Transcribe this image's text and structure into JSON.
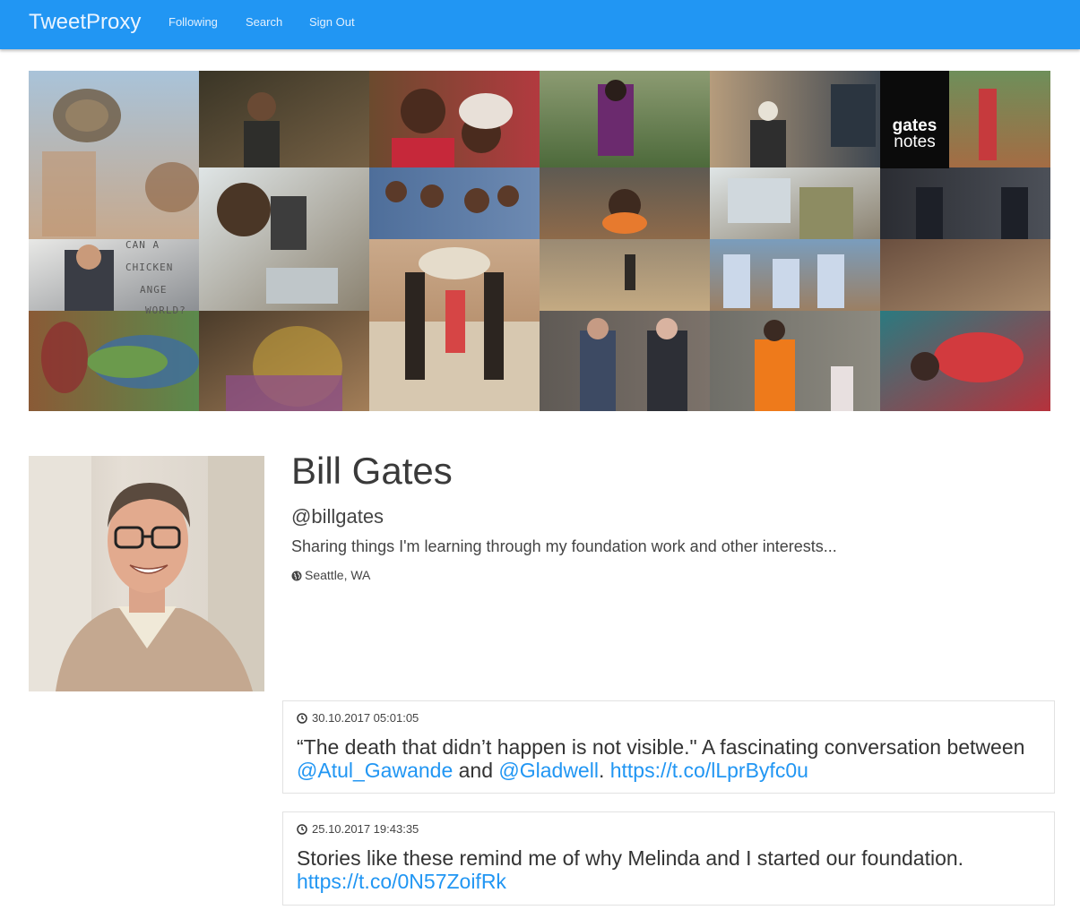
{
  "navbar": {
    "brand": "TweetProxy",
    "links": [
      "Following",
      "Search",
      "Sign Out"
    ]
  },
  "banner": {
    "logo_line1": "gates",
    "logo_line2": "notes",
    "chicken_lines": [
      "CAN A",
      "CHICKEN",
      "ANGE",
      "WORLD?"
    ]
  },
  "profile": {
    "name": "Bill Gates",
    "handle": "@billgates",
    "bio": "Sharing things I'm learning through my foundation work and other interests...",
    "location": "Seattle, WA"
  },
  "tweets": [
    {
      "time": "30.10.2017 05:01:05",
      "text_1": "“The death that didn’t happen is not visible.\" A fascinating conversation between ",
      "mention_1": "@Atul_Gawande",
      "text_2": " and ",
      "mention_2": "@Gladwell",
      "text_3": ". ",
      "link": "https://t.co/lLprByfc0u"
    },
    {
      "time": "25.10.2017 19:43:35",
      "text_1": "Stories like these remind me of why Melinda and I started our foundation. ",
      "link": "https://t.co/0N57ZoifRk"
    }
  ],
  "colors": {
    "navbar": "#2196f3",
    "link": "#2196f3"
  },
  "icons": {
    "location": "globe-icon",
    "time": "clock-icon"
  }
}
